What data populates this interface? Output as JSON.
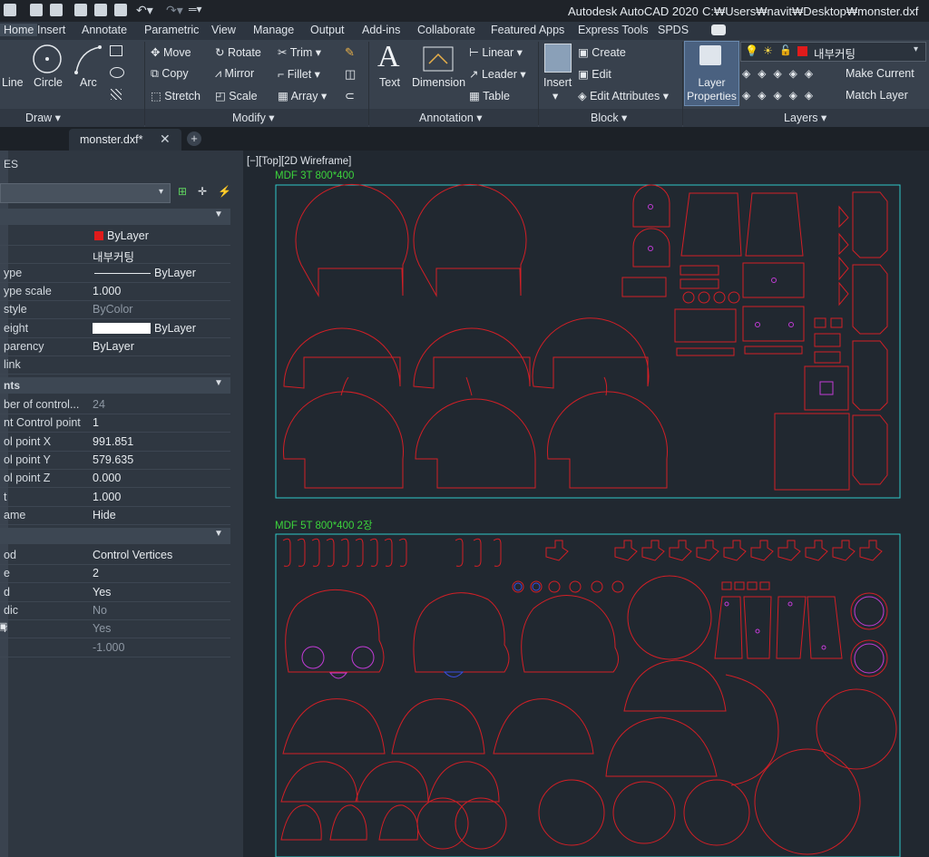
{
  "title_bar": {
    "app_title": "Autodesk AutoCAD 2020",
    "file_path": "C:₩Users₩navit₩Desktop₩monster.dxf"
  },
  "ribbon_tabs": [
    "Home",
    "Insert",
    "Annotate",
    "Parametric",
    "View",
    "Manage",
    "Output",
    "Add-ins",
    "Collaborate",
    "Featured Apps",
    "Express Tools",
    "SPDS"
  ],
  "ribbon": {
    "draw": {
      "line": "Line",
      "circle": "Circle",
      "arc": "Arc",
      "title": "Draw"
    },
    "modify": {
      "move": "Move",
      "rotate": "Rotate",
      "trim": "Trim",
      "copy": "Copy",
      "mirror": "Mirror",
      "fillet": "Fillet",
      "stretch": "Stretch",
      "scale": "Scale",
      "array": "Array",
      "title": "Modify"
    },
    "annotation": {
      "text": "Text",
      "dimension": "Dimension",
      "linear": "Linear",
      "leader": "Leader",
      "table": "Table",
      "title": "Annotation"
    },
    "block": {
      "insert": "Insert",
      "create": "Create",
      "edit": "Edit",
      "edit_attributes": "Edit Attributes",
      "title": "Block"
    },
    "layers": {
      "layer_properties_1": "Layer",
      "layer_properties_2": "Properties",
      "layer_dropdown": "내부커팅",
      "make_current": "Make Current",
      "match_layer": "Match Layer",
      "title": "Layers"
    }
  },
  "file_tab": {
    "name": "monster.dxf*"
  },
  "palette": {
    "header": "ES",
    "general_rows": [
      {
        "label": "",
        "value": "ByLayer"
      },
      {
        "label": "",
        "value": "내부커팅"
      },
      {
        "label": "ype",
        "value": "ByLayer"
      },
      {
        "label": "ype scale",
        "value": "1.000"
      },
      {
        "label": "style",
        "value": "ByColor"
      },
      {
        "label": "eight",
        "value": "ByLayer"
      },
      {
        "label": "parency",
        "value": "ByLayer"
      },
      {
        "label": "link",
        "value": ""
      }
    ],
    "section_points": "nts",
    "point_rows": [
      {
        "label": "ber of control...",
        "value": "24"
      },
      {
        "label": "nt Control point",
        "value": "1"
      },
      {
        "label": "ol point X",
        "value": "991.851"
      },
      {
        "label": "ol point Y",
        "value": "579.635"
      },
      {
        "label": "ol point Z",
        "value": "0.000"
      },
      {
        "label": "t",
        "value": "1.000"
      },
      {
        "label": "ame",
        "value": "Hide"
      }
    ],
    "misc_rows": [
      {
        "label": "od",
        "value": "Control Vertices"
      },
      {
        "label": "e",
        "value": "2"
      },
      {
        "label": "d",
        "value": "Yes"
      },
      {
        "label": "dic",
        "value": "No"
      },
      {
        "label": "r",
        "value": "Yes"
      },
      {
        "label": "",
        "value": "-1.000"
      }
    ]
  },
  "drawing": {
    "viewport_label": "[−][Top][2D Wireframe]",
    "group1_label": "MDF 3T 800*400",
    "group2_label": "MDF 5T 800*400 2장"
  },
  "colors": {
    "cut_red": "#d21f26",
    "frame_cyan": "#2fc9c9",
    "label_green": "#3cd43c",
    "magenta": "#c23bd6"
  }
}
